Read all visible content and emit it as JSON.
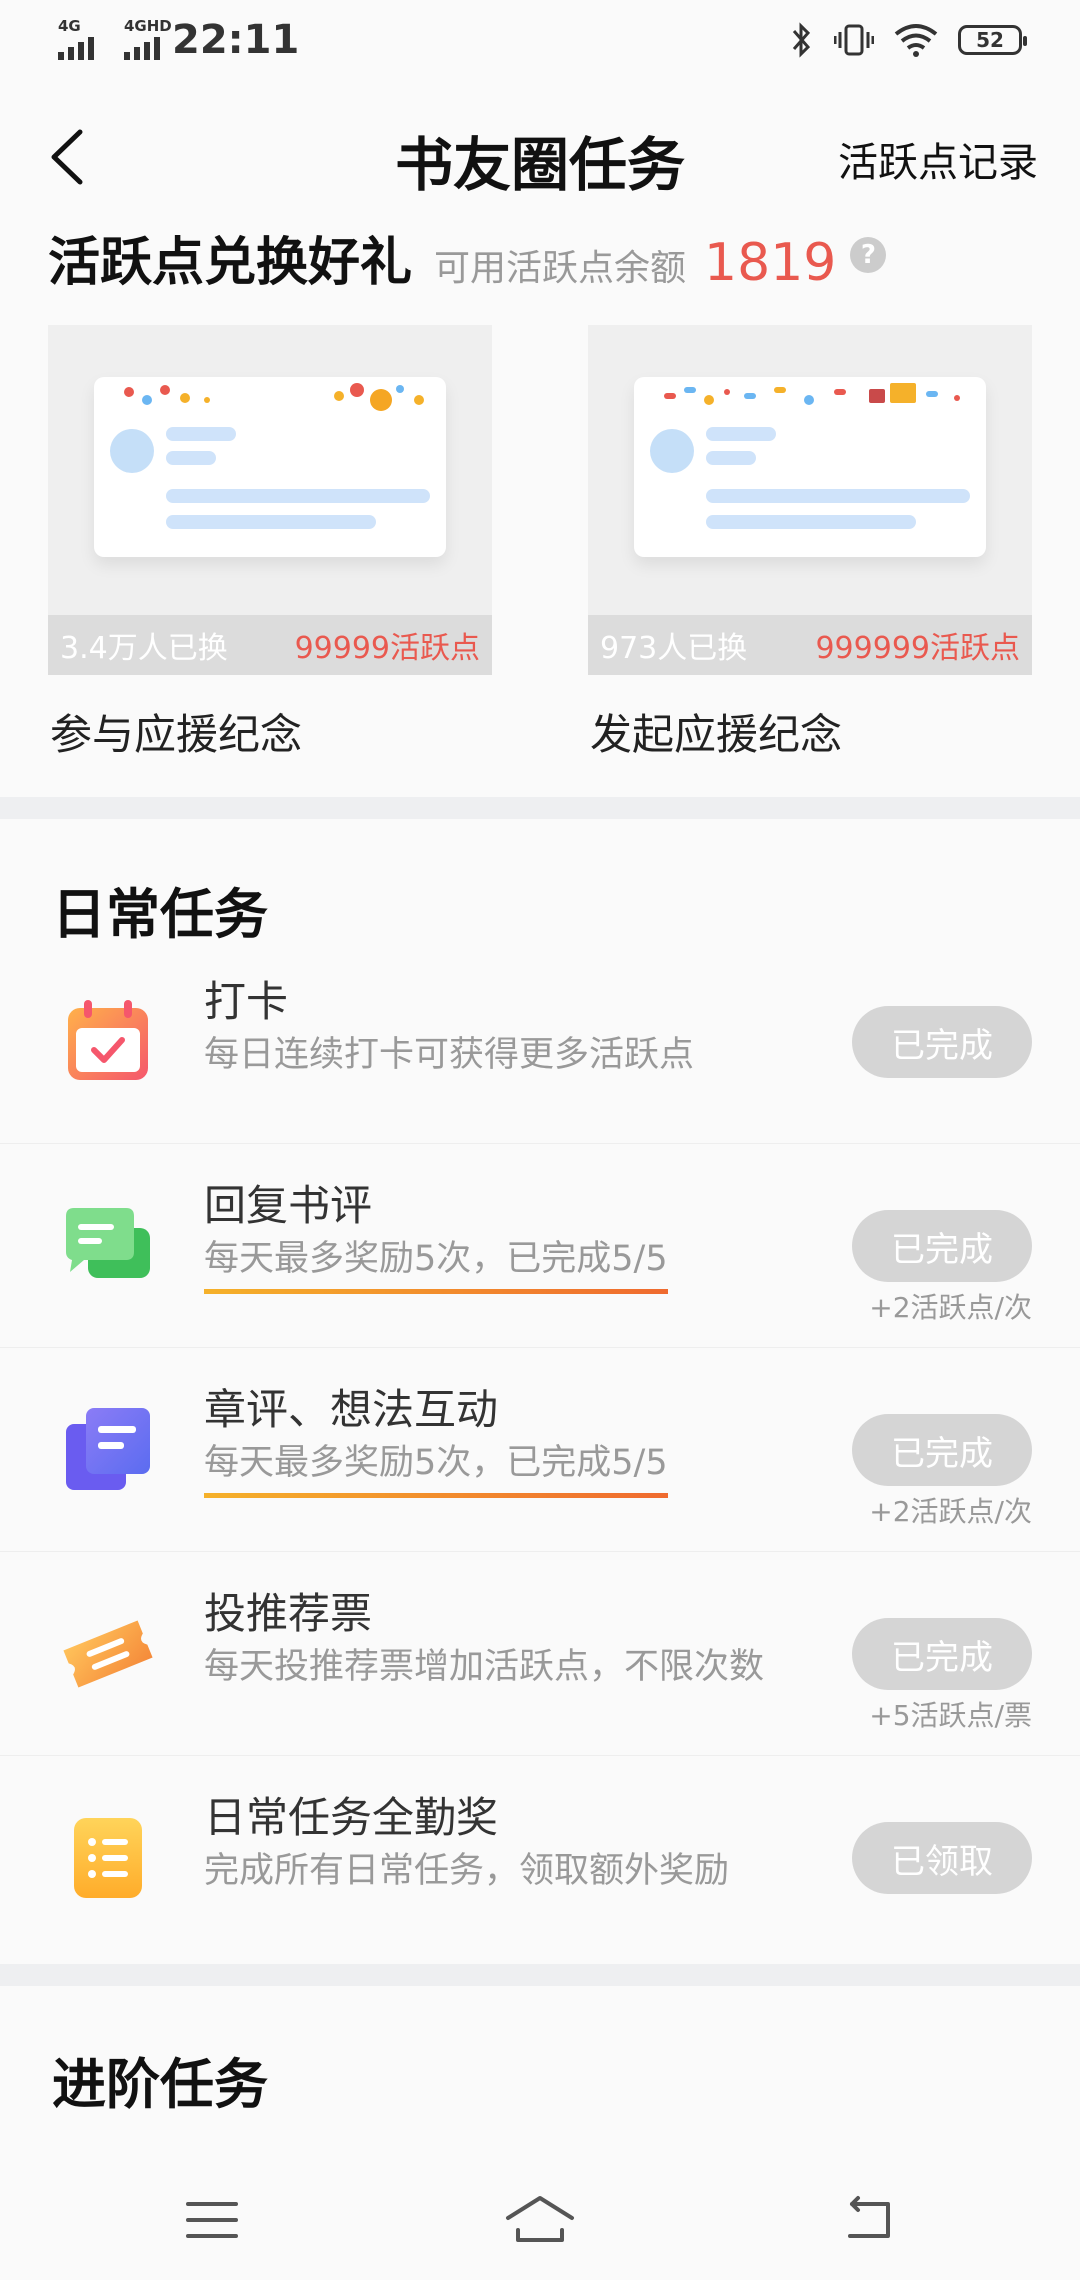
{
  "status": {
    "signal1": "4G",
    "signal2": "4GHD",
    "time": "22:11",
    "battery": "52"
  },
  "nav": {
    "title": "书友圈任务",
    "record_link": "活跃点记录"
  },
  "exchange": {
    "title": "活跃点兑换好礼",
    "balance_label": "可用活跃点余额",
    "balance_value": "1819",
    "help": "?",
    "gifts": [
      {
        "name": "参与应援纪念",
        "count": "3.4万人已换",
        "price": "99999活跃点"
      },
      {
        "name": "发起应援纪念",
        "count": "973人已换",
        "price": "999999活跃点"
      }
    ]
  },
  "daily": {
    "title": "日常任务",
    "tasks": [
      {
        "name": "打卡",
        "desc": "每日连续打卡可获得更多活跃点",
        "button": "已完成",
        "reward": "",
        "icon": "calendar-check-icon"
      },
      {
        "name": "回复书评",
        "desc": "每天最多奖励5次，已完成5/5",
        "button": "已完成",
        "reward": "+2活跃点/次",
        "icon": "chat-bubble-icon"
      },
      {
        "name": "章评、想法互动",
        "desc": "每天最多奖励5次，已完成5/5",
        "button": "已完成",
        "reward": "+2活跃点/次",
        "icon": "document-stack-icon"
      },
      {
        "name": "投推荐票",
        "desc": "每天投推荐票增加活跃点，不限次数",
        "button": "已完成",
        "reward": "+5活跃点/票",
        "icon": "ticket-icon"
      },
      {
        "name": "日常任务全勤奖",
        "desc": "完成所有日常任务，领取额外奖励",
        "button": "已领取",
        "reward": "",
        "icon": "list-icon"
      }
    ]
  },
  "advanced": {
    "title": "进阶任务"
  },
  "colors": {
    "accent_red": "#e9594f",
    "button_gray": "#d5d5d5",
    "underline_start": "#f5b12a",
    "underline_end": "#ef6a2f"
  }
}
